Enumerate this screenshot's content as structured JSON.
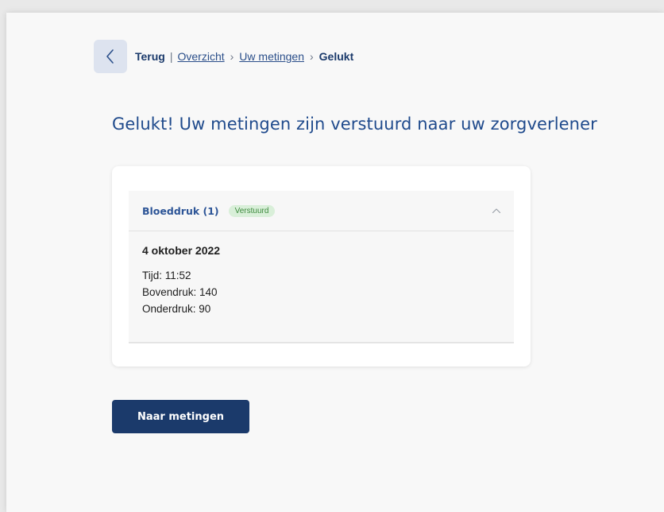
{
  "breadcrumb": {
    "back_label": "Terug",
    "separator": "|",
    "items": [
      {
        "label": "Overzicht"
      },
      {
        "label": "Uw metingen"
      },
      {
        "label": "Gelukt"
      }
    ]
  },
  "page": {
    "title": "Gelukt! Uw metingen zijn verstuurd naar uw zorgverlener"
  },
  "accordion": {
    "title": "Bloeddruk (1)",
    "badge": "Verstuurd",
    "expanded": true,
    "measurement": {
      "date": "4 oktober 2022",
      "time": "Tijd: 11:52",
      "systolic": "Bovendruk: 140",
      "diastolic": "Onderdruk: 90"
    }
  },
  "actions": {
    "primary_label": "Naar metingen"
  },
  "colors": {
    "brand": "#1b3a6b",
    "title": "#1f4a8c",
    "badge_bg": "#d9efd9",
    "badge_text": "#3d8a3d"
  },
  "icons": {
    "back": "chevron-left-icon",
    "accordion": "chevron-up-icon"
  }
}
